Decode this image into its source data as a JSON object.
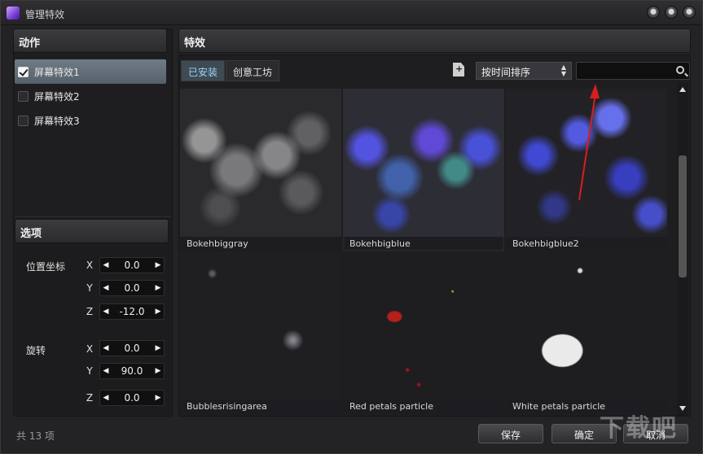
{
  "window": {
    "title": "管理特效"
  },
  "actions": {
    "header": "动作",
    "items": [
      {
        "label": "屏幕特效1",
        "checked": true
      },
      {
        "label": "屏幕特效2",
        "checked": false
      },
      {
        "label": "屏幕特效3",
        "checked": false
      }
    ]
  },
  "options": {
    "header": "选项",
    "position": {
      "label": "位置坐标",
      "x": "0.0",
      "y": "0.0",
      "z": "-12.0"
    },
    "rotation": {
      "label": "旋转",
      "x": "0.0",
      "y": "90.0",
      "z": "0.0"
    },
    "axes": {
      "x": "X",
      "y": "Y",
      "z": "Z"
    }
  },
  "effects": {
    "header": "特效",
    "tabs": [
      {
        "label": "已安装"
      },
      {
        "label": "创意工坊"
      }
    ],
    "sort": "按时间排序",
    "search_placeholder": "",
    "tiles": [
      {
        "name": "Bokehbiggray"
      },
      {
        "name": "Bokehbigblue"
      },
      {
        "name": "Bokehbigblue2"
      },
      {
        "name": "Bubblesrisingarea"
      },
      {
        "name": "Red petals particle"
      },
      {
        "name": "White petals particle"
      }
    ]
  },
  "footer": {
    "count": "共 13 项",
    "save": "保存",
    "ok": "确定",
    "cancel": "取消"
  },
  "watermark": "下载吧",
  "colors": {
    "accent_tab": "#9ed5ff",
    "selected_item": "#6f7c86",
    "annotation_arrow": "#d81e1e"
  }
}
